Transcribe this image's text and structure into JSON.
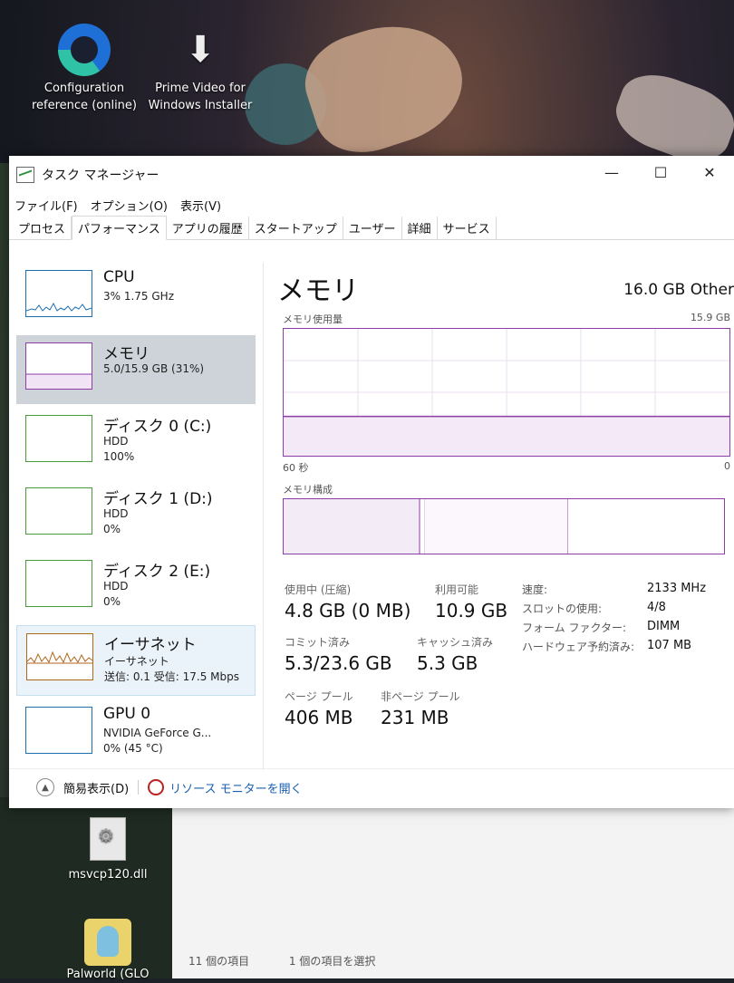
{
  "desktop": {
    "icons": [
      {
        "label_l1": "Configuration",
        "label_l2": "reference (online)"
      },
      {
        "label_l1": "Prime Video for",
        "label_l2": "Windows Installer"
      },
      {
        "label": "msvcp120.dll"
      },
      {
        "label": "Palworld (GLO"
      }
    ]
  },
  "window": {
    "title": "タスク マネージャー",
    "buttons": {
      "minimize": "—",
      "maximize": "☐",
      "close": "✕"
    },
    "menu": [
      "ファイル(F)",
      "オプション(O)",
      "表示(V)"
    ],
    "tabs": [
      "プロセス",
      "パフォーマンス",
      "アプリの履歴",
      "スタートアップ",
      "ユーザー",
      "詳細",
      "サービス"
    ],
    "active_tab": "パフォーマンス"
  },
  "sidebar": [
    {
      "title": "CPU",
      "l1": "3%  1.75 GHz",
      "l2": "",
      "color": "#1e6fb0"
    },
    {
      "title": "メモリ",
      "l1": "5.0/15.9 GB (31%)",
      "l2": "",
      "color": "#8b3ea6"
    },
    {
      "title": "ディスク 0 (C:)",
      "l1": "HDD",
      "l2": "100%",
      "color": "#4a9a3a"
    },
    {
      "title": "ディスク 1 (D:)",
      "l1": "HDD",
      "l2": "0%",
      "color": "#4a9a3a"
    },
    {
      "title": "ディスク 2 (E:)",
      "l1": "HDD",
      "l2": "0%",
      "color": "#4a9a3a"
    },
    {
      "title": "イーサネット",
      "l1": "イーサネット",
      "l2": "送信: 0.1  受信: 17.5 Mbps",
      "color": "#b0661b"
    },
    {
      "title": "GPU 0",
      "l1": "NVIDIA GeForce G...",
      "l2": "0% (45 °C)",
      "color": "#1e6fb0"
    }
  ],
  "main": {
    "title": "メモリ",
    "subtitle": "16.0 GB Other",
    "usage_label": "メモリ使用量",
    "usage_max": "15.9 GB",
    "time_left": "60 秒",
    "time_right": "0",
    "usage_fraction": 0.31,
    "composition_label": "メモリ構成",
    "stats": {
      "in_use_label": "使用中 (圧縮)",
      "in_use_value": "4.8 GB (0 MB)",
      "available_label": "利用可能",
      "available_value": "10.9 GB",
      "committed_label": "コミット済み",
      "committed_value": "5.3/23.6 GB",
      "cached_label": "キャッシュ済み",
      "cached_value": "5.3 GB",
      "paged_label": "ページ プール",
      "paged_value": "406 MB",
      "nonpaged_label": "非ページ プール",
      "nonpaged_value": "231 MB"
    },
    "details": [
      {
        "label": "速度:",
        "value": "2133 MHz"
      },
      {
        "label": "スロットの使用:",
        "value": "4/8"
      },
      {
        "label": "フォーム ファクター:",
        "value": "DIMM"
      },
      {
        "label": "ハードウェア予約済み:",
        "value": "107 MB"
      }
    ]
  },
  "footer": {
    "fewer_details": "簡易表示(D)",
    "resource_monitor": "リソース モニターを開く"
  },
  "explorer_status": {
    "items": "11 個の項目",
    "selected": "1 個の項目を選択"
  }
}
